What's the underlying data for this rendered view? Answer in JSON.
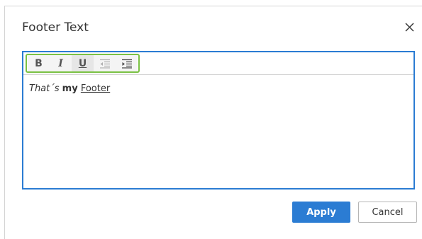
{
  "dialog": {
    "title": "Footer Text",
    "close_icon": "close-icon"
  },
  "toolbar": {
    "buttons": [
      {
        "name": "bold",
        "label": "B",
        "icon": "bold-icon"
      },
      {
        "name": "italic",
        "label": "I",
        "icon": "italic-icon"
      },
      {
        "name": "underline",
        "label": "U",
        "icon": "underline-icon"
      },
      {
        "name": "outdent",
        "icon": "outdent-icon"
      },
      {
        "name": "indent",
        "icon": "indent-icon"
      }
    ],
    "highlight_color": "#7ac143"
  },
  "editor": {
    "content": {
      "part1": "That´s",
      "part2": "my",
      "part3": "Footer"
    },
    "border_color": "#2b7cd3"
  },
  "actions": {
    "apply_label": "Apply",
    "cancel_label": "Cancel",
    "apply_color": "#2b7cd3"
  }
}
